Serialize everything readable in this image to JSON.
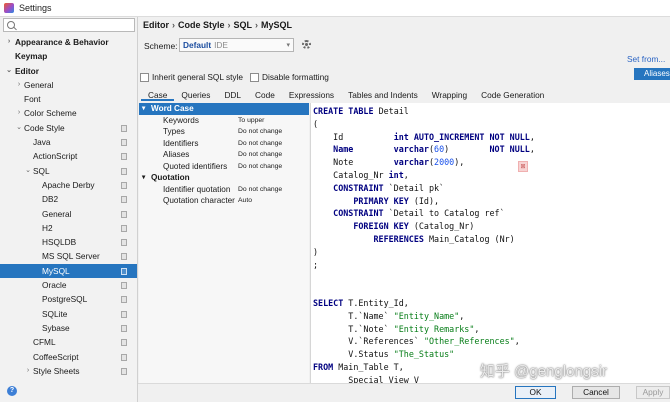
{
  "window": {
    "title": "Settings"
  },
  "sidebar": {
    "search_placeholder": "",
    "items": [
      {
        "label": "Appearance & Behavior",
        "arrow": "›",
        "bold": true,
        "indent": 0,
        "page": false,
        "selected": false
      },
      {
        "label": "Keymap",
        "arrow": "",
        "bold": true,
        "indent": 0,
        "page": false,
        "selected": false
      },
      {
        "label": "Editor",
        "arrow": "⌄",
        "bold": true,
        "indent": 0,
        "page": false,
        "selected": false
      },
      {
        "label": "General",
        "arrow": "›",
        "bold": false,
        "indent": 1,
        "page": false,
        "selected": false
      },
      {
        "label": "Font",
        "arrow": "",
        "bold": false,
        "indent": 1,
        "page": false,
        "selected": false
      },
      {
        "label": "Color Scheme",
        "arrow": "›",
        "bold": false,
        "indent": 1,
        "page": false,
        "selected": false
      },
      {
        "label": "Code Style",
        "arrow": "⌄",
        "bold": false,
        "indent": 1,
        "page": true,
        "selected": false
      },
      {
        "label": "Java",
        "arrow": "",
        "bold": false,
        "indent": 2,
        "page": true,
        "selected": false
      },
      {
        "label": "ActionScript",
        "arrow": "",
        "bold": false,
        "indent": 2,
        "page": true,
        "selected": false
      },
      {
        "label": "SQL",
        "arrow": "⌄",
        "bold": false,
        "indent": 2,
        "page": true,
        "selected": false
      },
      {
        "label": "Apache Derby",
        "arrow": "",
        "bold": false,
        "indent": 3,
        "page": true,
        "selected": false
      },
      {
        "label": "DB2",
        "arrow": "",
        "bold": false,
        "indent": 3,
        "page": true,
        "selected": false
      },
      {
        "label": "General",
        "arrow": "",
        "bold": false,
        "indent": 3,
        "page": true,
        "selected": false
      },
      {
        "label": "H2",
        "arrow": "",
        "bold": false,
        "indent": 3,
        "page": true,
        "selected": false
      },
      {
        "label": "HSQLDB",
        "arrow": "",
        "bold": false,
        "indent": 3,
        "page": true,
        "selected": false
      },
      {
        "label": "MS SQL Server",
        "arrow": "",
        "bold": false,
        "indent": 3,
        "page": true,
        "selected": false
      },
      {
        "label": "MySQL",
        "arrow": "",
        "bold": false,
        "indent": 3,
        "page": true,
        "selected": true
      },
      {
        "label": "Oracle",
        "arrow": "",
        "bold": false,
        "indent": 3,
        "page": true,
        "selected": false
      },
      {
        "label": "PostgreSQL",
        "arrow": "",
        "bold": false,
        "indent": 3,
        "page": true,
        "selected": false
      },
      {
        "label": "SQLite",
        "arrow": "",
        "bold": false,
        "indent": 3,
        "page": true,
        "selected": false
      },
      {
        "label": "Sybase",
        "arrow": "",
        "bold": false,
        "indent": 3,
        "page": true,
        "selected": false
      },
      {
        "label": "CFML",
        "arrow": "",
        "bold": false,
        "indent": 2,
        "page": true,
        "selected": false
      },
      {
        "label": "CoffeeScript",
        "arrow": "",
        "bold": false,
        "indent": 2,
        "page": true,
        "selected": false
      },
      {
        "label": "Style Sheets",
        "arrow": "›",
        "bold": false,
        "indent": 2,
        "page": true,
        "selected": false
      }
    ]
  },
  "help": {
    "label": "?"
  },
  "breadcrumb": {
    "parts": [
      "Editor",
      "Code Style",
      "SQL",
      "MySQL"
    ],
    "separator": "›"
  },
  "scheme": {
    "label": "Scheme:",
    "name": "Default",
    "type": "IDE"
  },
  "set_from": {
    "label": "Set from..."
  },
  "set_from_menu": {
    "selected": "Aliases"
  },
  "checkboxes": [
    {
      "label": "Inherit general SQL style",
      "checked": false
    },
    {
      "label": "Disable formatting",
      "checked": false
    }
  ],
  "tabs": [
    {
      "label": "Case",
      "active": true
    },
    {
      "label": "Queries",
      "active": false
    },
    {
      "label": "DDL",
      "active": false
    },
    {
      "label": "Code",
      "active": false
    },
    {
      "label": "Expressions",
      "active": false
    },
    {
      "label": "Tables and Indents",
      "active": false
    },
    {
      "label": "Wrapping",
      "active": false
    },
    {
      "label": "Code Generation",
      "active": false
    }
  ],
  "options": [
    {
      "label": "Word Case",
      "value": "",
      "group": true,
      "selected": true,
      "triangle": "▾"
    },
    {
      "label": "Keywords",
      "value": "To upper",
      "group": false,
      "selected": false,
      "triangle": ""
    },
    {
      "label": "Types",
      "value": "Do not change",
      "group": false,
      "selected": false,
      "triangle": ""
    },
    {
      "label": "Identifiers",
      "value": "Do not change",
      "group": false,
      "selected": false,
      "triangle": ""
    },
    {
      "label": "Aliases",
      "value": "Do not change",
      "group": false,
      "selected": false,
      "triangle": ""
    },
    {
      "label": "Quoted identifiers",
      "value": "Do not change",
      "group": false,
      "selected": false,
      "triangle": ""
    },
    {
      "label": "Quotation",
      "value": "",
      "group": true,
      "selected": false,
      "triangle": "▾"
    },
    {
      "label": "Identifier quotation",
      "value": "Do not change",
      "group": false,
      "selected": false,
      "triangle": ""
    },
    {
      "label": "Quotation character",
      "value": "Auto",
      "group": false,
      "selected": false,
      "triangle": ""
    }
  ],
  "code_lines": [
    [
      [
        "kw",
        "CREATE TABLE "
      ],
      [
        "",
        "Detail"
      ]
    ],
    [
      [
        "",
        "("
      ]
    ],
    [
      [
        "",
        "    Id          "
      ],
      [
        "kw",
        "int AUTO_INCREMENT NOT NULL"
      ],
      [
        "",
        ","
      ]
    ],
    [
      [
        "kw",
        "    Name        varchar"
      ],
      [
        "",
        "("
      ],
      [
        "num",
        "60"
      ],
      [
        "",
        ")        "
      ],
      [
        "kw",
        "NOT NULL"
      ],
      [
        "",
        ","
      ]
    ],
    [
      [
        "",
        "    Note        "
      ],
      [
        "kw",
        "varchar"
      ],
      [
        "",
        "("
      ],
      [
        "num",
        "2000"
      ],
      [
        "",
        "),"
      ]
    ],
    [
      [
        "",
        "    Catalog_Nr "
      ],
      [
        "kw",
        "int"
      ],
      [
        "",
        ","
      ]
    ],
    [
      [
        "kw",
        "    CONSTRAINT "
      ],
      [
        "",
        "`Detail pk`"
      ]
    ],
    [
      [
        "kw",
        "        PRIMARY KEY "
      ],
      [
        "",
        "(Id),"
      ]
    ],
    [
      [
        "kw",
        "    CONSTRAINT "
      ],
      [
        "",
        "`Detail to Catalog ref`"
      ]
    ],
    [
      [
        "kw",
        "        FOREIGN KEY "
      ],
      [
        "",
        "(Catalog_Nr)"
      ]
    ],
    [
      [
        "kw",
        "            REFERENCES "
      ],
      [
        "",
        "Main_Catalog (Nr)"
      ]
    ],
    [
      [
        "",
        ")"
      ]
    ],
    [
      [
        "",
        ";"
      ]
    ],
    [
      [
        "",
        ""
      ]
    ],
    [
      [
        "",
        ""
      ]
    ],
    [
      [
        "kw",
        "SELECT "
      ],
      [
        "",
        "T.Entity_Id,"
      ]
    ],
    [
      [
        "",
        "       T.`Name` "
      ],
      [
        "str",
        "\"Entity_Name\""
      ],
      [
        "",
        ","
      ]
    ],
    [
      [
        "",
        "       T.`Note` "
      ],
      [
        "str",
        "\"Entity Remarks\""
      ],
      [
        "",
        ","
      ]
    ],
    [
      [
        "",
        "       V.`References` "
      ],
      [
        "str",
        "\"Other_References\""
      ],
      [
        "",
        ","
      ]
    ],
    [
      [
        "",
        "       V.Status "
      ],
      [
        "str",
        "\"The_Status\""
      ]
    ],
    [
      [
        "kw",
        "FROM "
      ],
      [
        "",
        "Main_Table T,"
      ]
    ],
    [
      [
        "",
        "       Special_View V"
      ]
    ]
  ],
  "marker": {
    "label": "⊠"
  },
  "watermark": {
    "text": "知乎 @genglongsir"
  },
  "footer": {
    "ok": "OK",
    "cancel": "Cancel",
    "apply": "Apply"
  }
}
